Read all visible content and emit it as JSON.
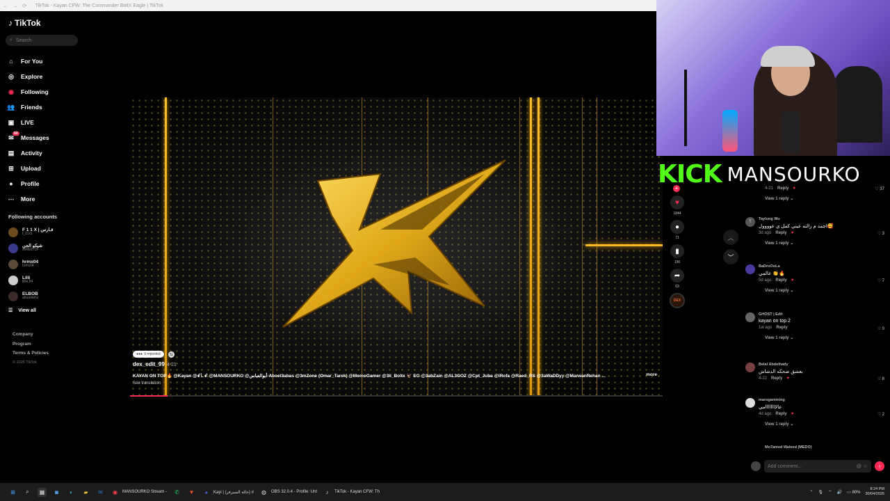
{
  "browser": {
    "title": "TikTok - Kayan CFW: The Commander BoltX Eagle | TikTok"
  },
  "sidebar": {
    "brand": "TikTok",
    "search_placeholder": "Search",
    "nav": [
      {
        "label": "For You",
        "icon": "home-icon"
      },
      {
        "label": "Explore",
        "icon": "compass-icon"
      },
      {
        "label": "Following",
        "icon": "following-icon"
      },
      {
        "label": "Friends",
        "icon": "friends-icon"
      },
      {
        "label": "LIVE",
        "icon": "live-icon"
      },
      {
        "label": "Messages",
        "icon": "messages-icon",
        "badge": "54"
      },
      {
        "label": "Activity",
        "icon": "activity-icon"
      },
      {
        "label": "Upload",
        "icon": "upload-icon"
      },
      {
        "label": "Profile",
        "icon": "profile-icon"
      },
      {
        "label": "More",
        "icon": "more-icon"
      }
    ],
    "following_title": "Following accounts",
    "accounts": [
      {
        "name": "F 1 1 X | فـارس",
        "handle": "f_11x1"
      },
      {
        "name": "شيكو الجن",
        "handle": "sheiko719"
      },
      {
        "name": "hrmx04",
        "handle": "hrmx04"
      },
      {
        "name": "Lilli",
        "handle": "lillin.84"
      },
      {
        "name": "ELBOB",
        "handle": "abuadamz"
      }
    ],
    "view_all": "View all",
    "footer": [
      "Company",
      "Program",
      "Terms & Policies"
    ],
    "copyright": "© 2026 TikTok"
  },
  "video": {
    "reposted": "9 reposted",
    "author": "dex_edit_99",
    "date": "4-21",
    "caption": "KAYAN ON TOP🔥 @Kayan @ꗃ꒒ꗃ @MANSOURKO @أبوالعباس-Aboel3abas @3mZone (Omar_Tarek) @MomoGamer @3li_Boltx 🦅 EG @3abZain @AL3GOZ @Cpt_Juba @iRofa @Raed_RS @3aWaDDyy @MarwanRehan ...",
    "more": "more",
    "see_translation": "See translation",
    "progress_fraction": 0.07
  },
  "actions": {
    "likes": "1844",
    "comments": "71",
    "saves": "156",
    "shares": "63",
    "sound_label": "DEX"
  },
  "overlay": {
    "kick": "KICK",
    "streamer": "MANSOURKO"
  },
  "comments": [
    {
      "user": "",
      "avatar": "",
      "text": "",
      "date": "4-21",
      "reply": "Reply",
      "likes": "37",
      "view_replies": "View 1 reply"
    },
    {
      "user": "Taylong Wu",
      "avatar": "T",
      "text": "اجمد م رالته عيني كمل ي عوووول🥰",
      "date": "3d ago",
      "reply": "Reply",
      "likes": "3",
      "view_replies": "View 1 reply"
    },
    {
      "user": "BaDroOoLa",
      "avatar": "",
      "text": "عالمي 👏🔥",
      "date": "5d ago",
      "reply": "Reply",
      "likes": "7",
      "view_replies": "View 1 reply"
    },
    {
      "user": "GHOST | Edit",
      "avatar": "",
      "text": "kayan on top 2",
      "date": "1w ago",
      "reply": "Reply",
      "likes": "0",
      "view_replies": "View 1 reply"
    },
    {
      "user": "Belal Abdelhady",
      "avatar": "",
      "text": "بعشق ضحكه الدشاش",
      "date": "4-22",
      "reply": "Reply",
      "likes": "8",
      "view_replies": ""
    },
    {
      "user": "marogamming",
      "avatar": "",
      "text": "عالاااااااامي",
      "date": "4d ago",
      "reply": "Reply",
      "likes": "2",
      "view_replies": "View 1 reply"
    },
    {
      "user": "Mo7amed Waleed (MEDO)",
      "avatar": "",
      "text": "",
      "date": "",
      "reply": "",
      "likes": "",
      "view_replies": ""
    }
  ],
  "add_comment_placeholder": "Add comment...",
  "taskbar": {
    "items": [
      "MANSOURKO Stream -",
      "Kayi | (حالة السيرفر) #",
      "OBS 32.0.4 - Profile: Unt",
      "TikTok - Kayan CFW: Th"
    ],
    "battery": "80%",
    "time": "8:24 PM",
    "date": "30/04/2026"
  },
  "colors": {
    "accent": "#fe2c55",
    "kick_green": "#53fc18",
    "gold": "#ffb820"
  }
}
